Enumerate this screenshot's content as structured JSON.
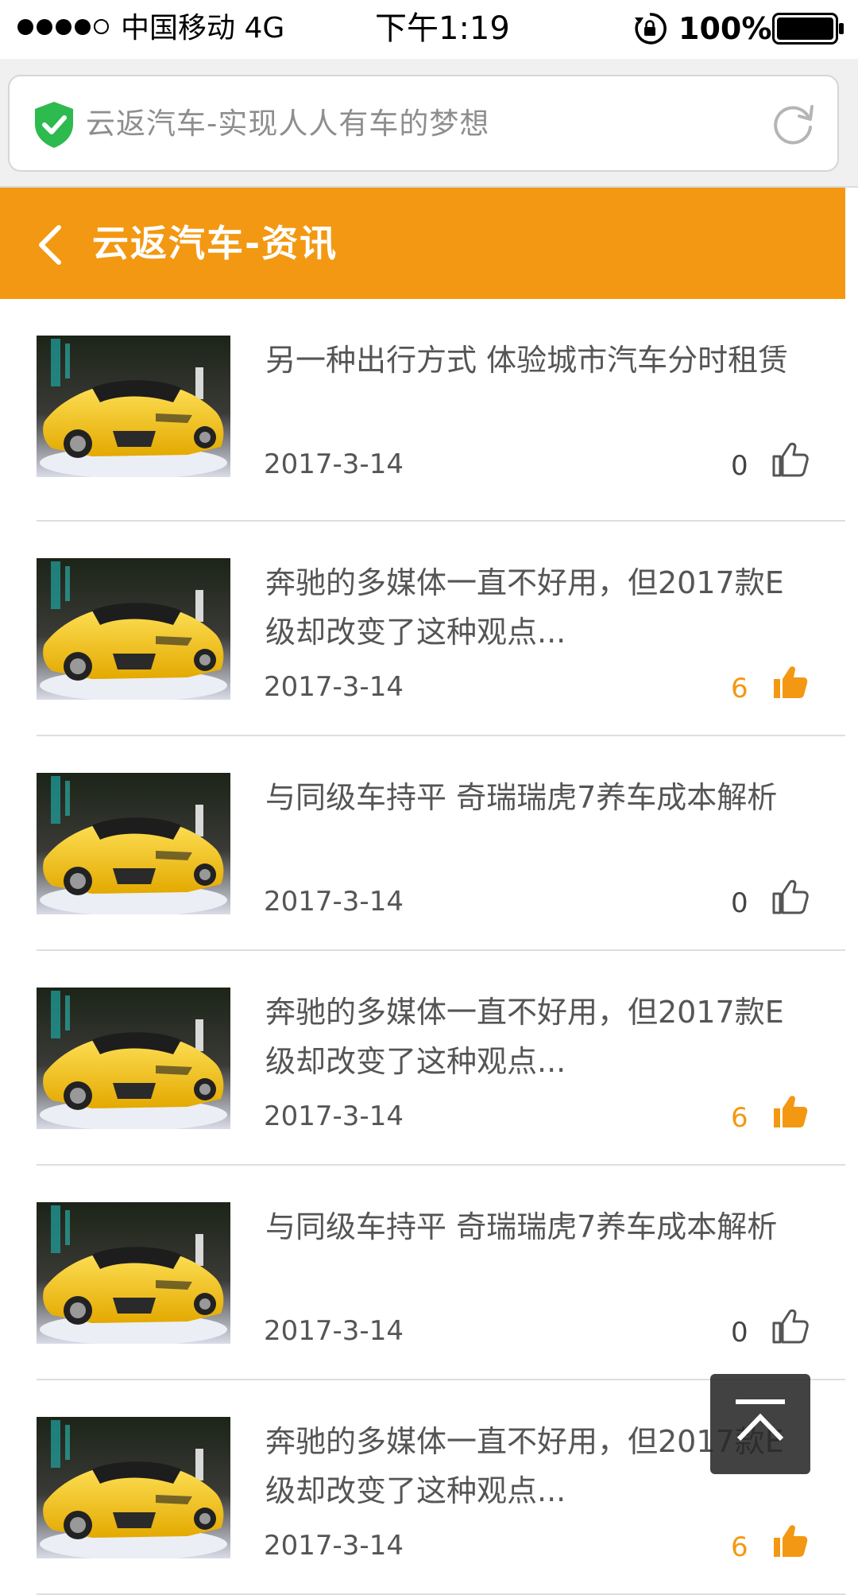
{
  "status_bar": {
    "carrier": "中国移动  4G",
    "time": "下午1:19",
    "battery": "100%"
  },
  "browser": {
    "url_title": "云返汽车-实现人人有车的梦想"
  },
  "header": {
    "title": "云返汽车-资讯"
  },
  "colors": {
    "accent": "#f39812",
    "text": "#555555",
    "divider": "#dedede"
  },
  "news": [
    {
      "title": "另一种出行方式 体验城市汽车分时租赁",
      "date": "2017-3-14",
      "likes": "0",
      "liked": false
    },
    {
      "title": "奔驰的多媒体一直不好用，但2017款E级却改变了这种观点...",
      "date": "2017-3-14",
      "likes": "6",
      "liked": true
    },
    {
      "title": "与同级车持平 奇瑞瑞虎7养车成本解析",
      "date": "2017-3-14",
      "likes": "0",
      "liked": false
    },
    {
      "title": "奔驰的多媒体一直不好用，但2017款E级却改变了这种观点...",
      "date": "2017-3-14",
      "likes": "6",
      "liked": true
    },
    {
      "title": "与同级车持平 奇瑞瑞虎7养车成本解析",
      "date": "2017-3-14",
      "likes": "0",
      "liked": false
    },
    {
      "title": "奔驰的多媒体一直不好用，但2017款E级却改变了这种观点...",
      "date": "2017-3-14",
      "likes": "6",
      "liked": true
    }
  ],
  "icons": {
    "back": "chevron-left-icon",
    "like": "thumbs-up-icon",
    "secure": "shield-check-icon",
    "reload": "reload-icon",
    "to_top": "arrow-up-icon"
  }
}
